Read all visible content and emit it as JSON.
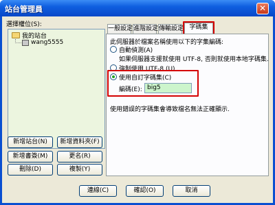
{
  "window": {
    "title": "站台管理員",
    "close_glyph": "✕"
  },
  "left": {
    "select_label": "選擇權位(S):",
    "tree": {
      "root": "我的站台",
      "child": "wang5555"
    },
    "buttons": {
      "new_site": "新增站台(N)",
      "new_folder": "新增資料夾(F)",
      "new_bookmark": "新增書簽(M)",
      "rename": "更名(R)",
      "delete": "刪除(D)",
      "copy": "複製(Y)"
    }
  },
  "tabs": [
    "一般設定",
    "進階設定",
    "傳輸設定",
    "字碼集"
  ],
  "active_tab_index": 3,
  "charset": {
    "intro": "此伺服器於檔案名稱使用以下的字集編碼:",
    "auto_detect": "自動偵測(A)",
    "auto_detect_desc": "如果伺服器支援就使用 UTF-8, 否則就使用本地字碼集.",
    "force_utf8": "強制使用 UTF-8 (U)",
    "custom": "使用自訂字碼集(C)",
    "encoding_label": "編碼(E):",
    "encoding_value": "big5",
    "warning": "使用錯誤的字碼集會導致檔名無法正確顯示.",
    "selected_option": "custom",
    "input_background": "#ccf5cc"
  },
  "footer": {
    "connect": "連線(C)",
    "ok": "確認(O)",
    "cancel": "取消"
  },
  "colors": {
    "highlight": "#d40000",
    "title_bar": "#0f5fe0",
    "tree_background": "#ecf5df"
  }
}
